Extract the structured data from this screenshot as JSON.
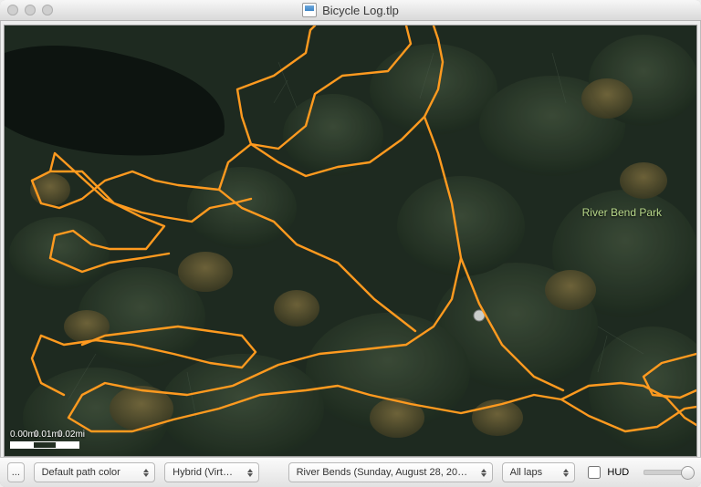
{
  "window": {
    "title": "Bicycle Log.tlp"
  },
  "map": {
    "park_label": "River Bend Park",
    "scale": {
      "t0": "0.00mi",
      "t1": "0.01mi",
      "t2": "0.02mi"
    },
    "track_color": "#ff9a1f"
  },
  "toolbar": {
    "menu_button": "...",
    "path_color": "Default path color",
    "map_type": "Hybrid (Virt…",
    "activity": "River Bends  (Sunday, August 28, 20…",
    "laps": "All laps",
    "hud_label": "HUD"
  }
}
